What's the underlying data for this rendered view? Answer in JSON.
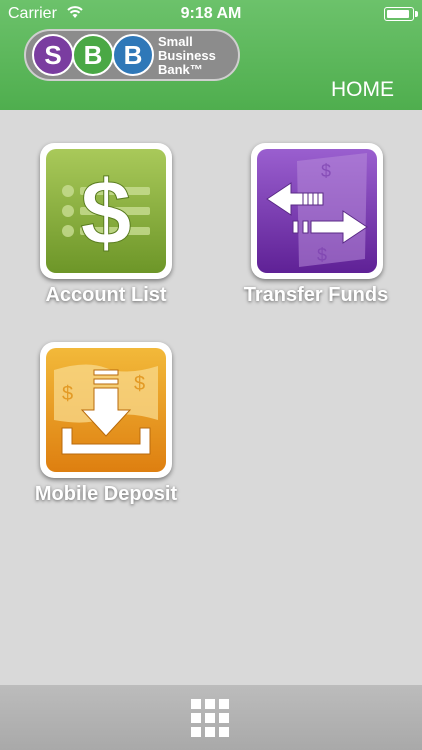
{
  "status_bar": {
    "carrier": "Carrier",
    "time": "9:18 AM",
    "battery_level": 1.0
  },
  "logo": {
    "letters": [
      "S",
      "B",
      "B"
    ],
    "brand_lines": [
      "Small",
      "Business",
      "Bank™"
    ]
  },
  "header": {
    "title": "HOME"
  },
  "tiles": [
    {
      "label": "Account List",
      "icon": "dollar-list-icon",
      "color": "#7ea83a"
    },
    {
      "label": "Transfer Funds",
      "icon": "transfer-arrows-icon",
      "color": "#7a3db0"
    },
    {
      "label": "Mobile Deposit",
      "icon": "deposit-download-icon",
      "color": "#e8961e"
    }
  ],
  "footer": {
    "icon": "grid-menu-icon"
  },
  "colors": {
    "header_green": "#5bb85a",
    "background": "#d9d9d9",
    "footer_gray": "#b3b3b3"
  }
}
